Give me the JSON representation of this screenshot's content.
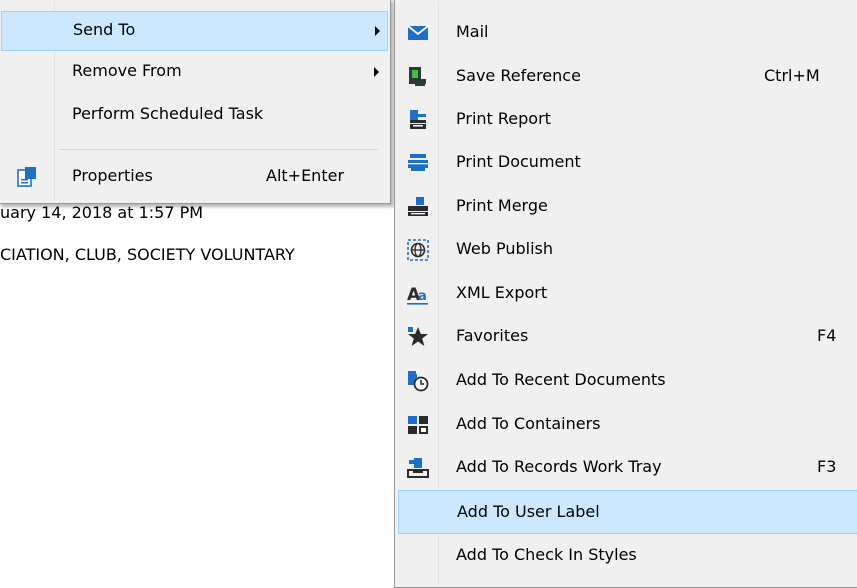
{
  "background": {
    "date_line": "uary 14, 2018 at 1:57 PM",
    "category_line": "CIATION, CLUB, SOCIETY VOLUNTARY"
  },
  "parent_menu": {
    "items": [
      {
        "label": "Send To",
        "has_submenu": true,
        "selected": true
      },
      {
        "label": "Remove From",
        "has_submenu": true
      },
      {
        "label": "Perform Scheduled Task"
      },
      {
        "label": "Properties",
        "shortcut": "Alt+Enter",
        "icon": "properties-icon"
      }
    ]
  },
  "send_to_menu": {
    "items": [
      {
        "label": "Mail",
        "icon": "mail-icon"
      },
      {
        "label": "Save Reference",
        "shortcut": "Ctrl+M",
        "icon": "save-reference-icon"
      },
      {
        "label": "Print Report",
        "icon": "print-report-icon"
      },
      {
        "label": "Print Document",
        "icon": "print-document-icon"
      },
      {
        "label": "Print Merge",
        "icon": "print-merge-icon"
      },
      {
        "label": "Web Publish",
        "icon": "web-publish-icon"
      },
      {
        "label": "XML Export",
        "icon": "xml-export-icon"
      },
      {
        "label": "Favorites",
        "shortcut": "F4",
        "icon": "favorites-star-icon"
      },
      {
        "label": "Add To Recent Documents",
        "icon": "recent-documents-icon"
      },
      {
        "label": "Add To Containers",
        "icon": "containers-icon"
      },
      {
        "label": "Add To Records Work Tray",
        "shortcut": "F3",
        "icon": "records-work-tray-icon"
      },
      {
        "label": "Add To User Label",
        "selected": true
      },
      {
        "label": "Add To Check In Styles"
      }
    ]
  },
  "colors": {
    "menu_bg": "#f0f0f0",
    "highlight_bg": "#cce8ff",
    "highlight_border": "#99d1ff",
    "icon_blue": "#1e6fc8"
  }
}
